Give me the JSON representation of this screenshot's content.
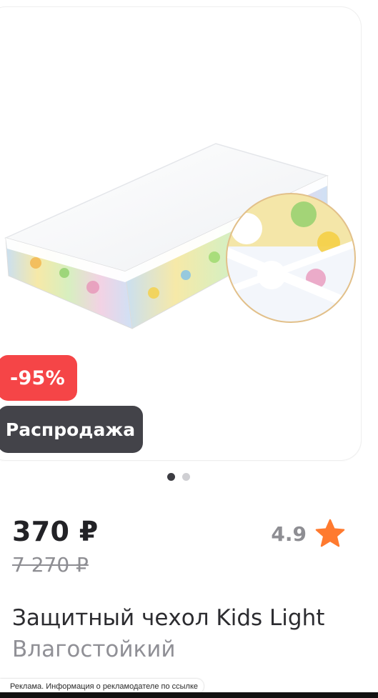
{
  "product": {
    "discount_badge": "-95%",
    "sale_badge": "Распродажа",
    "price": "370 ₽",
    "old_price": "7 270 ₽",
    "rating": "4.9",
    "title": "Защитный чехол Kids Light",
    "subtitle": "Влагостойкий",
    "gallery": {
      "total_images": 2,
      "active_index": 0
    },
    "image_icon": "mattress-product-image"
  },
  "ad_notice": "Реклама. Информация о рекламодателе по ссылке",
  "colors": {
    "discount": "#f54547",
    "sale_badge": "#434349",
    "star": "#ff7a2f"
  }
}
